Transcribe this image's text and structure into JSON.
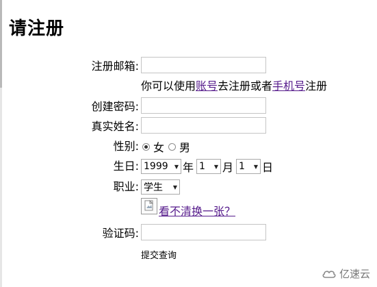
{
  "page": {
    "title": "请注册"
  },
  "form": {
    "email_label": "注册邮箱:",
    "email_value": "",
    "hint_prefix": "你可以使用",
    "hint_link1": "账号",
    "hint_middle": "去注册或者",
    "hint_link2": "手机号",
    "hint_suffix": "注册",
    "password_label": "创建密码:",
    "password_value": "",
    "realname_label": "真实姓名:",
    "realname_value": "",
    "gender_label": "性别:",
    "gender_female": "女",
    "gender_male": "男",
    "gender_selected": "女",
    "birthday_label": "生日:",
    "birth_year": "1999",
    "year_unit": "年",
    "birth_month": "1",
    "month_unit": "月",
    "birth_day": "1",
    "day_unit": "日",
    "job_label": "职业:",
    "job_value": "学生",
    "captcha_refresh": "看不清换一张？",
    "captcha_label": "验证码:",
    "captcha_value": "",
    "submit_label": "提交查询"
  },
  "watermark": {
    "text": "亿速云"
  },
  "icons": {
    "dropdown": "chevron-down-icon",
    "captcha": "broken-image-icon",
    "brand": "cloud-logo-icon"
  }
}
